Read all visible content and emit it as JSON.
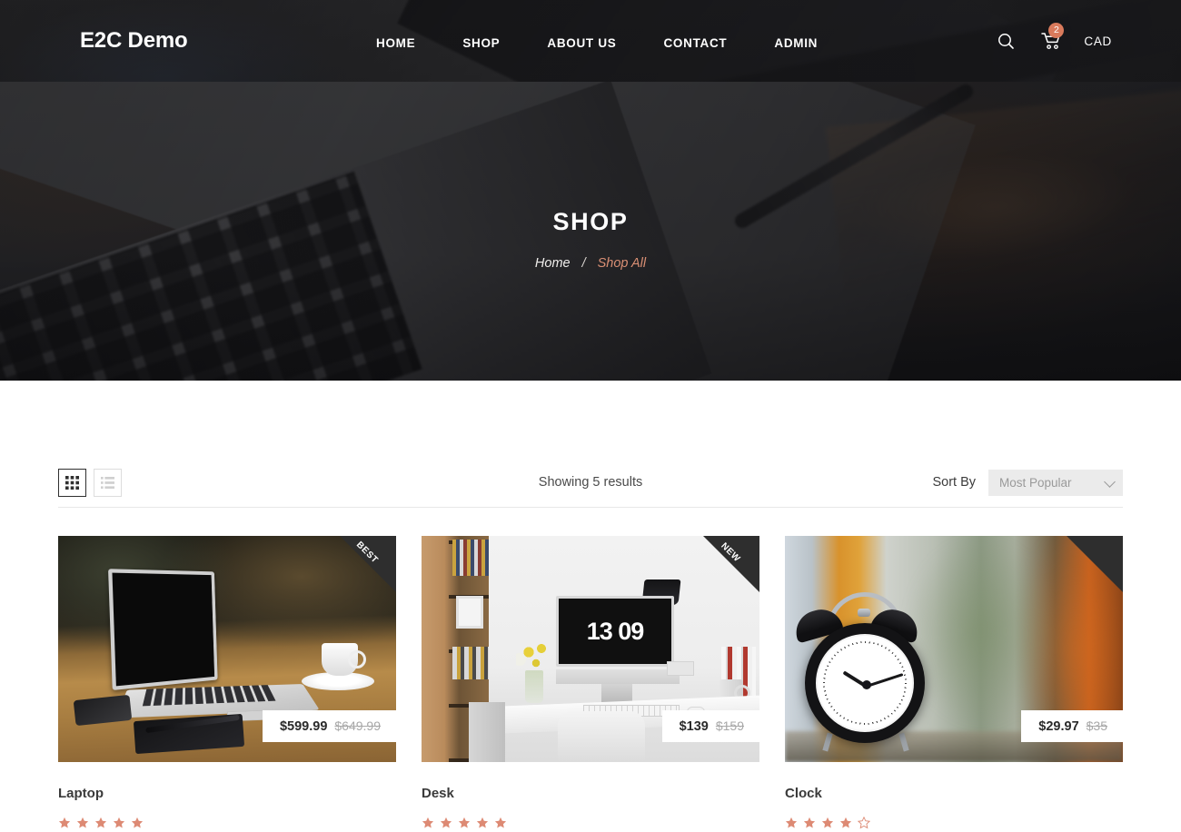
{
  "header": {
    "brand": "E2C Demo",
    "nav": [
      {
        "label": "HOME"
      },
      {
        "label": "SHOP"
      },
      {
        "label": "ABOUT US"
      },
      {
        "label": "CONTACT"
      },
      {
        "label": "ADMIN"
      }
    ],
    "search_icon": "search-icon",
    "cart_icon": "shopping-cart-icon",
    "cart_count": "2",
    "cart_badge_color": "#d97a5c",
    "currency": "CAD"
  },
  "hero": {
    "title": "SHOP",
    "breadcrumb": {
      "home": "Home",
      "separator": "/",
      "current": "Shop All",
      "current_color": "#d98f74"
    }
  },
  "toolbar": {
    "grid_view_icon": "grid-view-icon",
    "list_view_icon": "list-view-icon",
    "active_view": "grid",
    "results_text": "Showing 5 results",
    "sort_label": "Sort By",
    "sort_value": "Most Popular",
    "sort_options": [
      "Most Popular"
    ],
    "chevron_icon": "chevron-down-icon"
  },
  "products": [
    {
      "name": "Laptop",
      "ribbon": "BEST",
      "price": "$599.99",
      "compare_price": "$649.99",
      "rating": 5,
      "rating_max": 5,
      "image_alt": "laptop-on-wooden-desk-photo",
      "screen_text": ""
    },
    {
      "name": "Desk",
      "ribbon": "NEW",
      "price": "$139",
      "compare_price": "$159",
      "rating": 5,
      "rating_max": 5,
      "image_alt": "desk-workspace-imac-photo",
      "screen_text": "13 09"
    },
    {
      "name": "Clock",
      "ribbon": "",
      "price": "$29.97",
      "compare_price": "$35",
      "rating": 4,
      "rating_max": 5,
      "image_alt": "alarm-clock-photo",
      "screen_text": ""
    }
  ],
  "theme": {
    "star_color": "#dd8a74",
    "ribbon_bg": "#2e2e2e",
    "accent": "#d97a5c"
  }
}
